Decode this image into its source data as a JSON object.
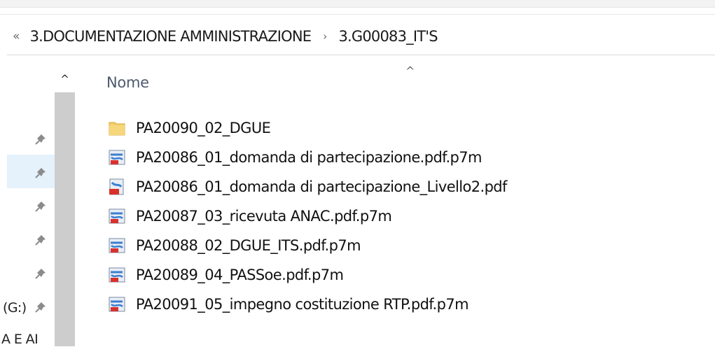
{
  "breadcrumb": {
    "overflow_glyph": "«",
    "segments": [
      "3.DOCUMENTAZIONE AMMINISTRAZIONE",
      "3.G00083_IT'S"
    ],
    "separator": "›"
  },
  "nav_pane": {
    "icons": [
      "pin-icon",
      "pin-icon",
      "pin-icon",
      "pin-icon",
      "pin-icon",
      "pin-icon"
    ],
    "drive_label": "(G:)",
    "partial_label": "A E AI",
    "scroll_up_glyph": "^"
  },
  "column_header": {
    "name_label": "Nome",
    "sort_glyph": "^"
  },
  "files": [
    {
      "name": "PA20090_02_DGUE",
      "type": "folder"
    },
    {
      "name": "PA20086_01_domanda di partecipazione.pdf.p7m",
      "type": "p7m"
    },
    {
      "name": "PA20086_01_domanda di partecipazione_Livello2.pdf",
      "type": "pdf"
    },
    {
      "name": "PA20087_03_ricevuta ANAC.pdf.p7m",
      "type": "p7m"
    },
    {
      "name": "PA20088_02_DGUE_ITS.pdf.p7m",
      "type": "p7m"
    },
    {
      "name": "PA20089_04_PASSoe.pdf.p7m",
      "type": "p7m"
    },
    {
      "name": "PA20091_05_impegno costituzione RTP.pdf.p7m",
      "type": "p7m"
    }
  ],
  "colors": {
    "selection": "#e5f1fb",
    "folder": "#f3cf67",
    "pdf_red": "#d8312b",
    "icon_blue": "#3b7fd1"
  }
}
